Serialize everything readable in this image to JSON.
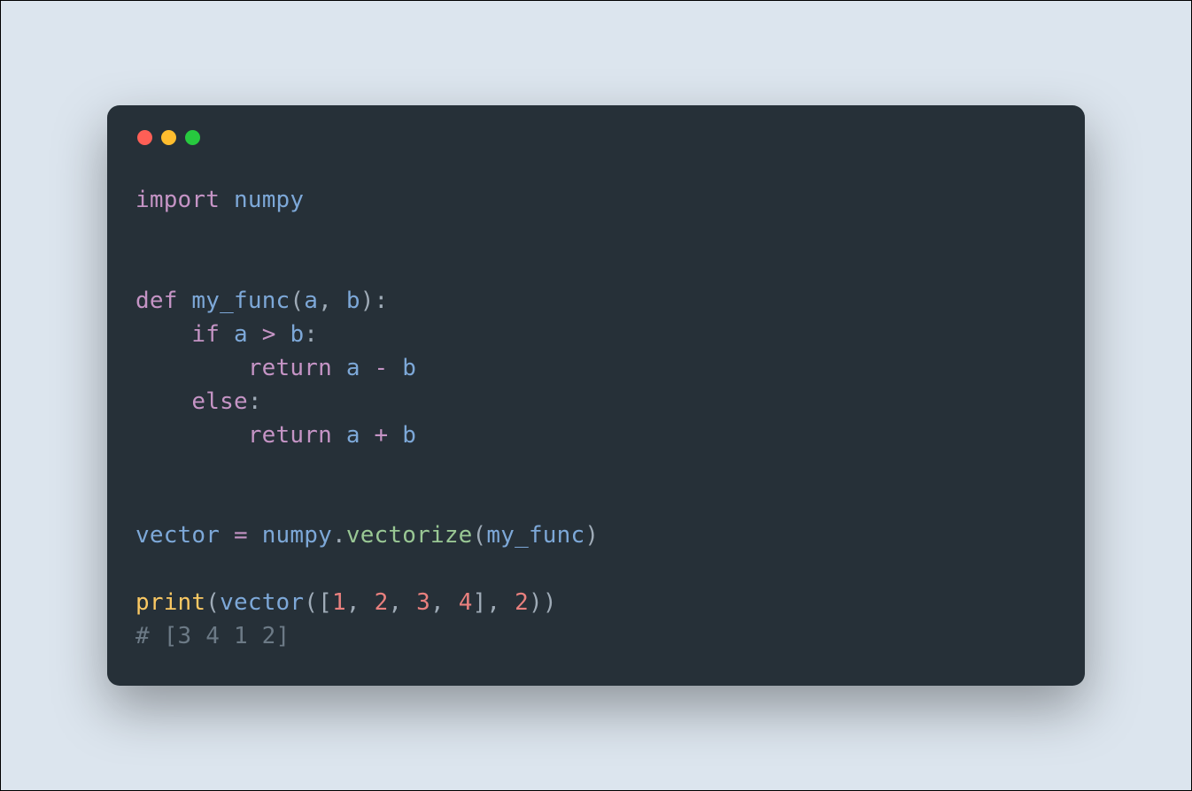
{
  "code": {
    "line1": {
      "kw": "import",
      "mod": "numpy"
    },
    "line3": {
      "kw": "def",
      "fn": "my_func",
      "p1": "a",
      "p2": "b"
    },
    "line4": {
      "kw": "if",
      "v1": "a",
      "op": ">",
      "v2": "b"
    },
    "line5": {
      "kw": "return",
      "v1": "a",
      "op": "-",
      "v2": "b"
    },
    "line6": {
      "kw": "else"
    },
    "line7": {
      "kw": "return",
      "v1": "a",
      "op": "+",
      "v2": "b"
    },
    "line9": {
      "v": "vector",
      "op": "=",
      "mod": "numpy",
      "meth": "vectorize",
      "arg": "my_func"
    },
    "line11": {
      "call": "print",
      "v": "vector",
      "n1": "1",
      "n2": "2",
      "n3": "3",
      "n4": "4",
      "n5": "2"
    },
    "line12": {
      "cmt": "# [3 4 1 2]"
    }
  }
}
